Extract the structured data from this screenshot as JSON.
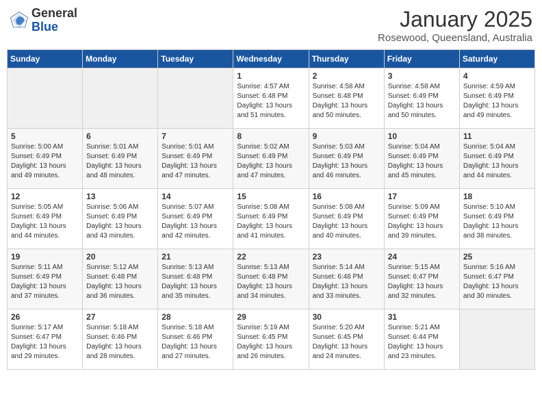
{
  "header": {
    "logo_general": "General",
    "logo_blue": "Blue",
    "month": "January 2025",
    "location": "Rosewood, Queensland, Australia"
  },
  "weekdays": [
    "Sunday",
    "Monday",
    "Tuesday",
    "Wednesday",
    "Thursday",
    "Friday",
    "Saturday"
  ],
  "weeks": [
    [
      {
        "day": "",
        "sunrise": "",
        "sunset": "",
        "daylight": "",
        "empty": true
      },
      {
        "day": "",
        "sunrise": "",
        "sunset": "",
        "daylight": "",
        "empty": true
      },
      {
        "day": "",
        "sunrise": "",
        "sunset": "",
        "daylight": "",
        "empty": true
      },
      {
        "day": "1",
        "sunrise": "Sunrise: 4:57 AM",
        "sunset": "Sunset: 6:48 PM",
        "daylight": "Daylight: 13 hours and 51 minutes."
      },
      {
        "day": "2",
        "sunrise": "Sunrise: 4:58 AM",
        "sunset": "Sunset: 6:48 PM",
        "daylight": "Daylight: 13 hours and 50 minutes."
      },
      {
        "day": "3",
        "sunrise": "Sunrise: 4:58 AM",
        "sunset": "Sunset: 6:49 PM",
        "daylight": "Daylight: 13 hours and 50 minutes."
      },
      {
        "day": "4",
        "sunrise": "Sunrise: 4:59 AM",
        "sunset": "Sunset: 6:49 PM",
        "daylight": "Daylight: 13 hours and 49 minutes."
      }
    ],
    [
      {
        "day": "5",
        "sunrise": "Sunrise: 5:00 AM",
        "sunset": "Sunset: 6:49 PM",
        "daylight": "Daylight: 13 hours and 49 minutes."
      },
      {
        "day": "6",
        "sunrise": "Sunrise: 5:01 AM",
        "sunset": "Sunset: 6:49 PM",
        "daylight": "Daylight: 13 hours and 48 minutes."
      },
      {
        "day": "7",
        "sunrise": "Sunrise: 5:01 AM",
        "sunset": "Sunset: 6:49 PM",
        "daylight": "Daylight: 13 hours and 47 minutes."
      },
      {
        "day": "8",
        "sunrise": "Sunrise: 5:02 AM",
        "sunset": "Sunset: 6:49 PM",
        "daylight": "Daylight: 13 hours and 47 minutes."
      },
      {
        "day": "9",
        "sunrise": "Sunrise: 5:03 AM",
        "sunset": "Sunset: 6:49 PM",
        "daylight": "Daylight: 13 hours and 46 minutes."
      },
      {
        "day": "10",
        "sunrise": "Sunrise: 5:04 AM",
        "sunset": "Sunset: 6:49 PM",
        "daylight": "Daylight: 13 hours and 45 minutes."
      },
      {
        "day": "11",
        "sunrise": "Sunrise: 5:04 AM",
        "sunset": "Sunset: 6:49 PM",
        "daylight": "Daylight: 13 hours and 44 minutes."
      }
    ],
    [
      {
        "day": "12",
        "sunrise": "Sunrise: 5:05 AM",
        "sunset": "Sunset: 6:49 PM",
        "daylight": "Daylight: 13 hours and 44 minutes."
      },
      {
        "day": "13",
        "sunrise": "Sunrise: 5:06 AM",
        "sunset": "Sunset: 6:49 PM",
        "daylight": "Daylight: 13 hours and 43 minutes."
      },
      {
        "day": "14",
        "sunrise": "Sunrise: 5:07 AM",
        "sunset": "Sunset: 6:49 PM",
        "daylight": "Daylight: 13 hours and 42 minutes."
      },
      {
        "day": "15",
        "sunrise": "Sunrise: 5:08 AM",
        "sunset": "Sunset: 6:49 PM",
        "daylight": "Daylight: 13 hours and 41 minutes."
      },
      {
        "day": "16",
        "sunrise": "Sunrise: 5:08 AM",
        "sunset": "Sunset: 6:49 PM",
        "daylight": "Daylight: 13 hours and 40 minutes."
      },
      {
        "day": "17",
        "sunrise": "Sunrise: 5:09 AM",
        "sunset": "Sunset: 6:49 PM",
        "daylight": "Daylight: 13 hours and 39 minutes."
      },
      {
        "day": "18",
        "sunrise": "Sunrise: 5:10 AM",
        "sunset": "Sunset: 6:49 PM",
        "daylight": "Daylight: 13 hours and 38 minutes."
      }
    ],
    [
      {
        "day": "19",
        "sunrise": "Sunrise: 5:11 AM",
        "sunset": "Sunset: 6:49 PM",
        "daylight": "Daylight: 13 hours and 37 minutes."
      },
      {
        "day": "20",
        "sunrise": "Sunrise: 5:12 AM",
        "sunset": "Sunset: 6:48 PM",
        "daylight": "Daylight: 13 hours and 36 minutes."
      },
      {
        "day": "21",
        "sunrise": "Sunrise: 5:13 AM",
        "sunset": "Sunset: 6:48 PM",
        "daylight": "Daylight: 13 hours and 35 minutes."
      },
      {
        "day": "22",
        "sunrise": "Sunrise: 5:13 AM",
        "sunset": "Sunset: 6:48 PM",
        "daylight": "Daylight: 13 hours and 34 minutes."
      },
      {
        "day": "23",
        "sunrise": "Sunrise: 5:14 AM",
        "sunset": "Sunset: 6:48 PM",
        "daylight": "Daylight: 13 hours and 33 minutes."
      },
      {
        "day": "24",
        "sunrise": "Sunrise: 5:15 AM",
        "sunset": "Sunset: 6:47 PM",
        "daylight": "Daylight: 13 hours and 32 minutes."
      },
      {
        "day": "25",
        "sunrise": "Sunrise: 5:16 AM",
        "sunset": "Sunset: 6:47 PM",
        "daylight": "Daylight: 13 hours and 30 minutes."
      }
    ],
    [
      {
        "day": "26",
        "sunrise": "Sunrise: 5:17 AM",
        "sunset": "Sunset: 6:47 PM",
        "daylight": "Daylight: 13 hours and 29 minutes."
      },
      {
        "day": "27",
        "sunrise": "Sunrise: 5:18 AM",
        "sunset": "Sunset: 6:46 PM",
        "daylight": "Daylight: 13 hours and 28 minutes."
      },
      {
        "day": "28",
        "sunrise": "Sunrise: 5:18 AM",
        "sunset": "Sunset: 6:46 PM",
        "daylight": "Daylight: 13 hours and 27 minutes."
      },
      {
        "day": "29",
        "sunrise": "Sunrise: 5:19 AM",
        "sunset": "Sunset: 6:45 PM",
        "daylight": "Daylight: 13 hours and 26 minutes."
      },
      {
        "day": "30",
        "sunrise": "Sunrise: 5:20 AM",
        "sunset": "Sunset: 6:45 PM",
        "daylight": "Daylight: 13 hours and 24 minutes."
      },
      {
        "day": "31",
        "sunrise": "Sunrise: 5:21 AM",
        "sunset": "Sunset: 6:44 PM",
        "daylight": "Daylight: 13 hours and 23 minutes."
      },
      {
        "day": "",
        "sunrise": "",
        "sunset": "",
        "daylight": "",
        "empty": true
      }
    ]
  ]
}
